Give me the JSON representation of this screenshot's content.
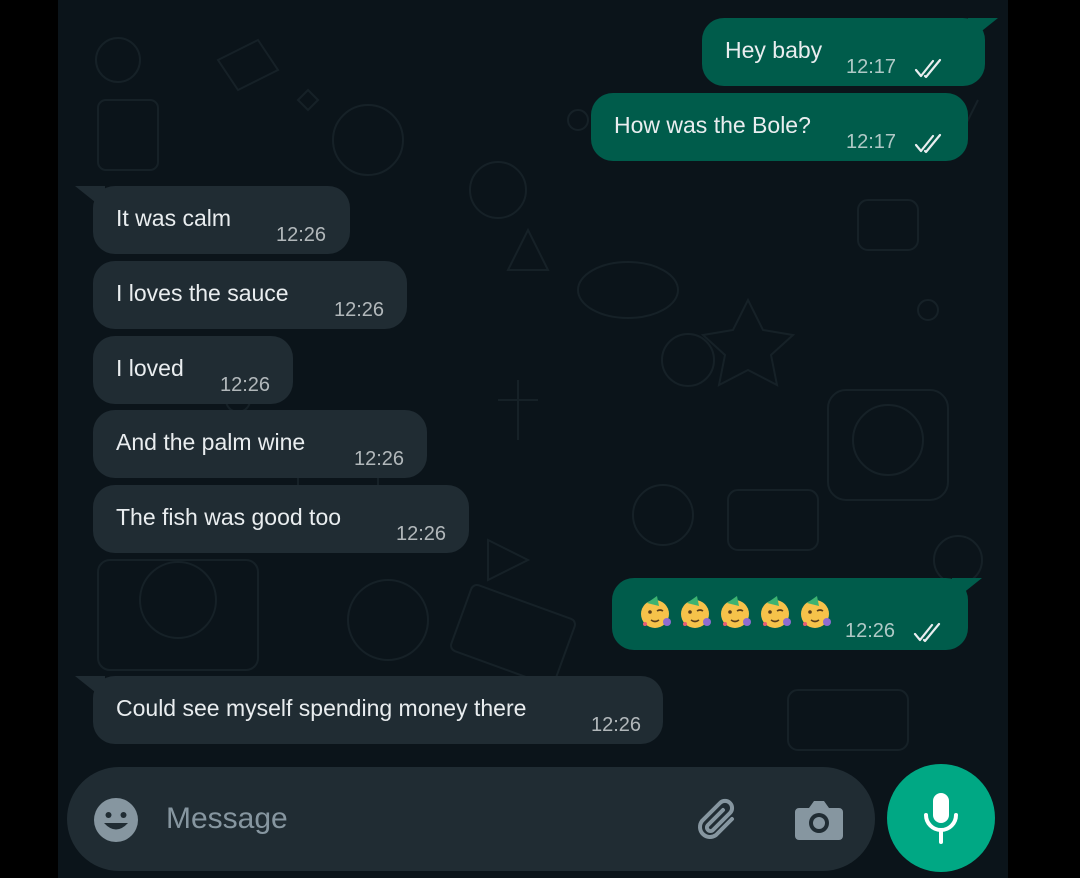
{
  "theme": {
    "background": "#0b141a",
    "outgoing_bubble": "#005c4b",
    "incoming_bubble": "#202c33",
    "text": "#e9edef",
    "muted": "#8696a0",
    "accent": "#00a884",
    "read_ticks": "#e9edef"
  },
  "messages": [
    {
      "direction": "out",
      "text": "Hey baby",
      "time": "12:17",
      "status": "read",
      "status_icon": "double-check-icon"
    },
    {
      "direction": "out",
      "text": "How was the Bole?",
      "time": "12:17",
      "status": "read",
      "status_icon": "double-check-icon"
    },
    {
      "direction": "in",
      "text": "It was calm",
      "time": "12:26"
    },
    {
      "direction": "in",
      "text": "I loves the sauce",
      "time": "12:26"
    },
    {
      "direction": "in",
      "text": "I loved",
      "time": "12:26"
    },
    {
      "direction": "in",
      "text": "And the palm wine",
      "time": "12:26"
    },
    {
      "direction": "in",
      "text": "The fish was good too",
      "time": "12:26"
    },
    {
      "direction": "out",
      "emoji_count": 5,
      "emoji": "partying-face-emoji",
      "time": "12:26",
      "status": "read",
      "status_icon": "double-check-icon"
    },
    {
      "direction": "in",
      "text": "Could see myself spending money there",
      "time": "12:26"
    }
  ],
  "composer": {
    "placeholder": "Message",
    "emoji_icon": "smiley-icon",
    "attach_icon": "paperclip-icon",
    "camera_icon": "camera-icon",
    "send_icon": "microphone-icon"
  }
}
